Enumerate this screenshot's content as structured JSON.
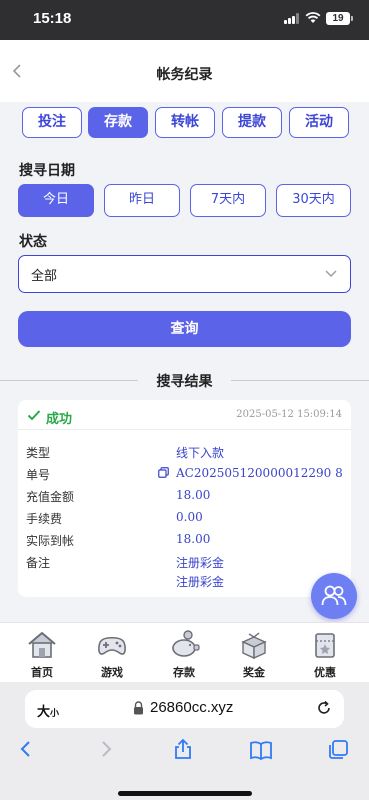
{
  "status_bar": {
    "time": "15:18",
    "battery": "19"
  },
  "header": {
    "title": "帐务纪录"
  },
  "tabs": [
    {
      "label": "投注",
      "active": false
    },
    {
      "label": "存款",
      "active": true
    },
    {
      "label": "转帐",
      "active": false
    },
    {
      "label": "提款",
      "active": false
    },
    {
      "label": "活动",
      "active": false
    }
  ],
  "search_date": {
    "label": "搜寻日期",
    "options": [
      {
        "label": "今日",
        "active": true
      },
      {
        "label": "昨日",
        "active": false
      },
      {
        "label": "7天内",
        "active": false
      },
      {
        "label": "30天内",
        "active": false
      }
    ]
  },
  "status_filter": {
    "label": "状态",
    "value": "全部"
  },
  "query_button": "查询",
  "results": {
    "title": "搜寻结果",
    "record": {
      "status": "成功",
      "timestamp": "2025-05-12 15:09:14",
      "rows": [
        {
          "label": "类型",
          "value": "线下入款"
        },
        {
          "label": "单号",
          "value": "AC202505120000012290 8"
        },
        {
          "label": "充值金额",
          "value": "18.00"
        },
        {
          "label": "手续费",
          "value": "0.00"
        },
        {
          "label": "实际到帐",
          "value": "18.00"
        },
        {
          "label": "备注",
          "value": "注册彩金",
          "value2": "注册彩金"
        }
      ]
    }
  },
  "bottom_nav": [
    {
      "label": "首页",
      "icon": "home-icon"
    },
    {
      "label": "游戏",
      "icon": "gamepad-icon"
    },
    {
      "label": "存款",
      "icon": "piggy-bank-icon"
    },
    {
      "label": "奖金",
      "icon": "gift-box-icon"
    },
    {
      "label": "优惠",
      "icon": "coupon-icon"
    }
  ],
  "browser": {
    "text_size_big": "大",
    "text_size_small": "小",
    "url": "26860cc.xyz"
  },
  "colors": {
    "accent": "#5b63e8",
    "accent_text": "#3d46d6",
    "success": "#2aa84a",
    "value_blue": "#3a44c9"
  }
}
